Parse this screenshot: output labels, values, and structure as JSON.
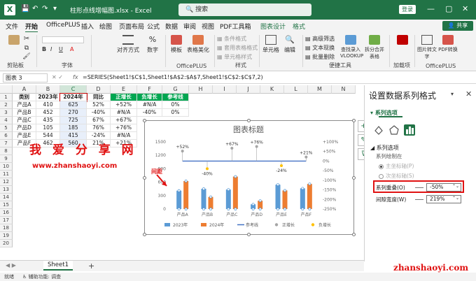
{
  "app": {
    "filename": "柱形点线增幅图.xlsx",
    "app_name": "Excel",
    "search_placeholder": "搜索",
    "login": "登录"
  },
  "tabs": [
    "文件",
    "开始",
    "OfficePLUS",
    "插入",
    "绘图",
    "页面布局",
    "公式",
    "数据",
    "审阅",
    "视图",
    "PDF工具箱",
    "图表设计",
    "格式"
  ],
  "share": "共享",
  "ribbon": {
    "groups": [
      "剪贴板",
      "字体",
      "对齐方式",
      "数字",
      "样式",
      "单元格",
      "OfficePLUS",
      "便捷工具",
      "编辑",
      "加载项",
      "OfficePLUS"
    ],
    "buttons": {
      "align": "对齐方式",
      "number": "数字",
      "template": "模板",
      "table_beautify": "表格美化",
      "cond_fmt": "条件格式",
      "table_fmt": "套用表格格式",
      "cell_style": "单元格样式",
      "cells": "单元格",
      "adv_filter": "高级筛选",
      "text_conv": "文本现换",
      "batch_delete": "批量删除",
      "edit": "编辑",
      "vlookup": "查找录入VLOOKUP",
      "split_merge": "拆分合并表格",
      "addins": "加载项",
      "img_to_text": "图片转文字",
      "pdf_conv": "PDF转换",
      "style_label": "样式"
    }
  },
  "formula": {
    "name_box": "图表 3",
    "fx": "fx",
    "content": "=SERIES(Sheet1!$C$1,Sheet1!$A$2:$A$7,Sheet1!$C$2:$C$7,2)"
  },
  "columns": [
    "A",
    "B",
    "C",
    "D",
    "E",
    "F",
    "G",
    "H",
    "I",
    "J",
    "K",
    "L",
    "M",
    "N"
  ],
  "rows": [
    "1",
    "2",
    "3",
    "4",
    "5",
    "6",
    "7",
    "8",
    "9",
    "10",
    "11",
    "12",
    "13",
    "14",
    "15",
    "16",
    "17",
    "18",
    "19",
    "20"
  ],
  "table": {
    "headers": [
      "类别",
      "2023年",
      "2024年",
      "同比",
      "正增长",
      "负增长",
      "参考线"
    ],
    "rows": [
      [
        "产品A",
        "410",
        "625",
        "52%",
        "+52%",
        "#N/A",
        "0%"
      ],
      [
        "产品B",
        "452",
        "270",
        "-40%",
        "#N/A",
        "-40%",
        "0%"
      ],
      [
        "产品C",
        "435",
        "725",
        "67%",
        "+67%",
        "#N/A",
        "0%"
      ],
      [
        "产品D",
        "105",
        "185",
        "76%",
        "+76%",
        "#N/A",
        "0%"
      ],
      [
        "产品E",
        "544",
        "415",
        "-24%",
        "#N/A",
        "-24%",
        "0%"
      ],
      [
        "产品F",
        "462",
        "560",
        "21%",
        "+21%",
        "#N/A",
        "0%"
      ]
    ]
  },
  "chart_data": {
    "type": "bar",
    "title": "图表标题",
    "categories": [
      "产品A",
      "产品B",
      "产品C",
      "产品D",
      "产品E",
      "产品F"
    ],
    "series": [
      {
        "name": "2023年",
        "values": [
          410,
          452,
          435,
          105,
          544,
          462
        ],
        "color": "#5b9bd5"
      },
      {
        "name": "2024年",
        "values": [
          625,
          270,
          725,
          185,
          415,
          560
        ],
        "color": "#ed7d31"
      }
    ],
    "lines": [
      {
        "name": "参考线",
        "values": [
          0,
          0,
          0,
          0,
          0,
          0
        ],
        "color": "#4472c4"
      },
      {
        "name": "正增长",
        "values": [
          52,
          null,
          67,
          76,
          null,
          21
        ],
        "labels": [
          "+52%",
          "",
          "+67%",
          "+76%",
          "",
          "+21%"
        ],
        "color": "#a5a5a5"
      },
      {
        "name": "负增长",
        "values": [
          null,
          -40,
          null,
          null,
          -24,
          null
        ],
        "labels": [
          "",
          "-40%",
          "",
          "",
          "-24%",
          ""
        ],
        "color": "#ffc000"
      }
    ],
    "yleft": {
      "ticks": [
        "0",
        "300",
        "600",
        "900",
        "1200",
        "1500"
      ],
      "range": [
        0,
        1500
      ]
    },
    "yright": {
      "ticks": [
        "+100%",
        "+50%",
        "0%",
        "-50%",
        "-100%",
        "-150%",
        "-200%",
        "-250%"
      ],
      "range": [
        -250,
        100
      ]
    },
    "legend": [
      "2023年",
      "2024年",
      "参考线",
      "正增长",
      "负增长"
    ],
    "legend_position": "bottom"
  },
  "pane": {
    "title": "设置数据系列格式",
    "subtitle": "系列选项",
    "section": "系列选项",
    "plot_on": "系列绘制在",
    "primary": "主坐标轴(P)",
    "secondary": "次坐标轴(S)",
    "overlap_label": "系列重叠(O)",
    "overlap_value": "-50%",
    "gap_label": "间隙宽度(W)",
    "gap_value": "219%"
  },
  "sheet": {
    "name": "Sheet1",
    "add": "+"
  },
  "status": {
    "ready": "就绪",
    "accessibility": "辅助功能: 调查"
  },
  "overlays": {
    "wm_title": "我 爱 分 享 网",
    "wm_url": "www.zhanshaoyi.com",
    "annotation": "间距",
    "wm_bottom": "zhanshaoyi.com"
  }
}
